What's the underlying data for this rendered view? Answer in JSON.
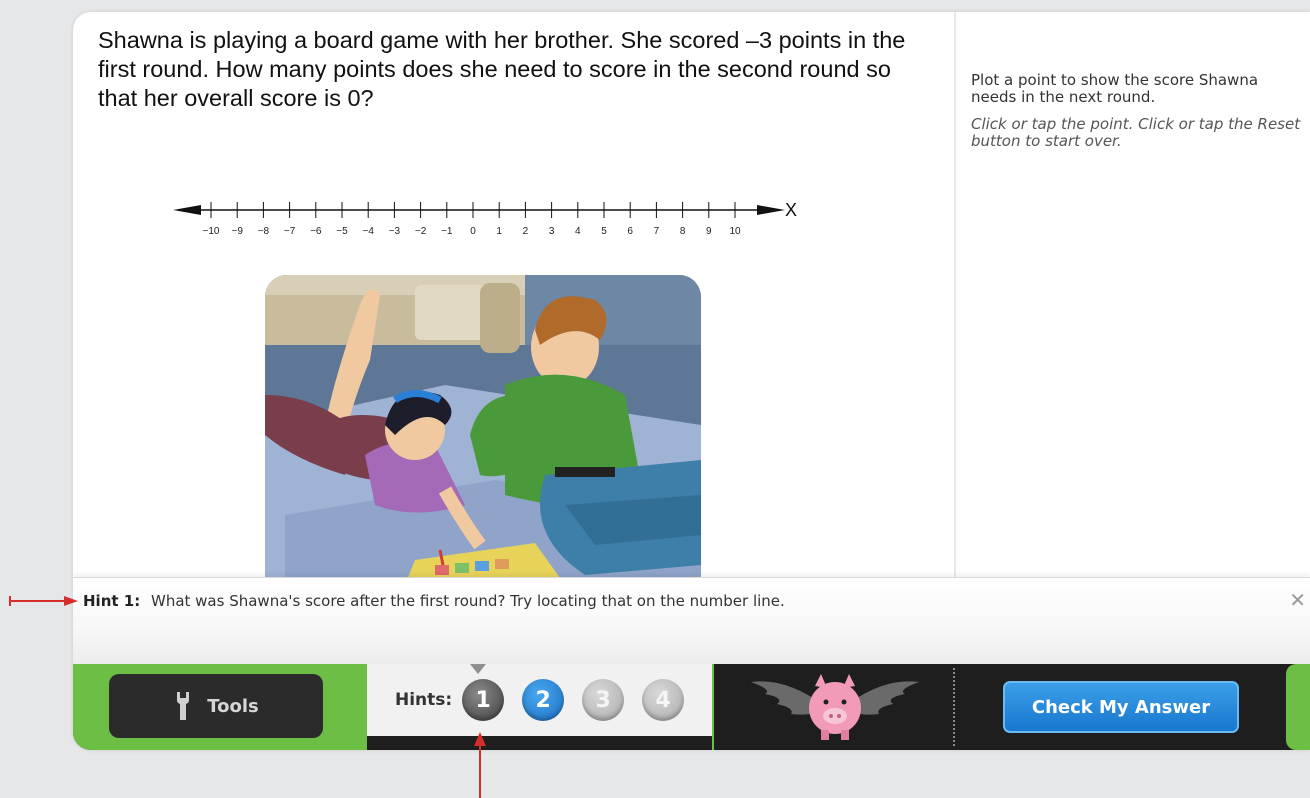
{
  "question": {
    "text": "Shawna is playing a board game with her brother. She scored –3 points in the first round. How many points does she need to score in the second round so that her overall score is 0?"
  },
  "number_line": {
    "axis_label": "X",
    "ticks": [
      "−10",
      "−9",
      "−8",
      "−7",
      "−6",
      "−5",
      "−4",
      "−3",
      "−2",
      "−1",
      "0",
      "1",
      "2",
      "3",
      "4",
      "5",
      "6",
      "7",
      "8",
      "9",
      "10"
    ]
  },
  "instructions": {
    "main": "Plot a point to show the score Shawna needs in the next round.",
    "note": "Click or tap the point. Click or tap the Reset button to start over."
  },
  "hint_panel": {
    "label": "Hint 1:",
    "text": "What was Shawna's score after the first round? Try locating that on the number line.",
    "close": "✕"
  },
  "toolbar": {
    "tools_label": "Tools",
    "hints_label": "Hints:",
    "hint_buttons": [
      "1",
      "2",
      "3",
      "4"
    ],
    "check_label": "Check My Answer"
  },
  "colors": {
    "green": "#6cbe45",
    "blue": "#1877cf",
    "dark_bar": "#1e1e1e",
    "arrow_red": "#d62d2d"
  },
  "icons": [
    "wrench-icon",
    "close-icon",
    "winged-pig-icon"
  ]
}
